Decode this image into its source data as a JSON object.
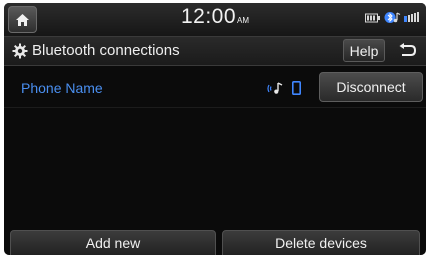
{
  "status_bar": {
    "time": "12:00",
    "ampm": "AM",
    "icons": [
      "home-icon",
      "battery-icon",
      "bluetooth-audio-icon",
      "signal-icon"
    ]
  },
  "title_bar": {
    "title": "Bluetooth connections",
    "title_icon": "gear-icon",
    "help_label": "Help",
    "back_icon": "back-arrow-icon"
  },
  "devices": [
    {
      "name": "Phone Name",
      "icons": [
        "bluetooth-audio-icon",
        "phone-icon"
      ],
      "action_label": "Disconnect"
    }
  ],
  "bottom": {
    "add_new_label": "Add new",
    "delete_devices_label": "Delete devices"
  },
  "colors": {
    "background": "#0b0b0b",
    "device_name": "#4a8ff0",
    "accent_blue": "#3f86ff",
    "text": "#f0f0f0"
  }
}
